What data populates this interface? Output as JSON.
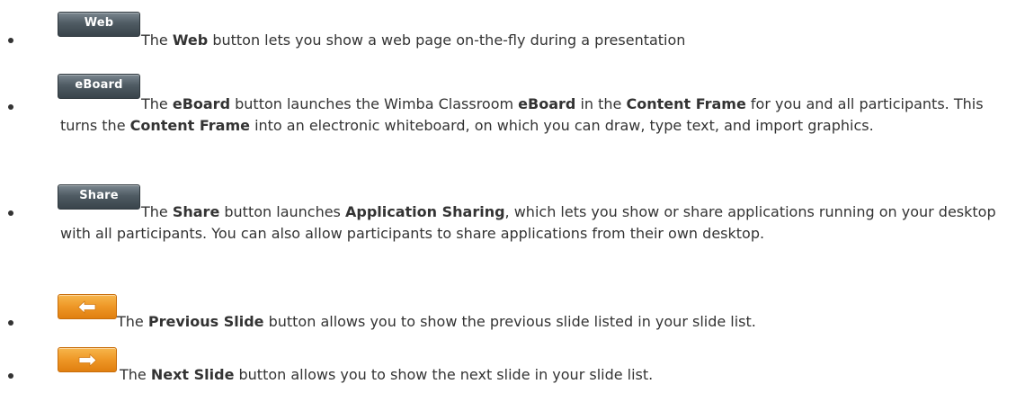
{
  "items": [
    {
      "button_label": "Web",
      "icon": "web-button-icon",
      "parts": [
        "The ",
        "Web",
        " button lets you show a web page on-the-fly during a presentation"
      ]
    },
    {
      "button_label": "eBoard",
      "icon": "eboard-button-icon",
      "parts": [
        "The ",
        "eBoard",
        " button launches the Wimba Classroom ",
        "eBoard",
        " in the ",
        "Content Frame",
        " for you and all participants. This turns the ",
        "Content Frame",
        " into an electronic whiteboard, on which you can draw, type text, and import graphics."
      ]
    },
    {
      "button_label": "Share",
      "icon": "share-button-icon",
      "parts": [
        "The ",
        "Share",
        " button launches ",
        "Application Sharing",
        ", which lets you show or share applications running on your desktop with all participants. You can also allow participants to share applications from their own desktop."
      ]
    },
    {
      "icon": "previous-slide-arrow-icon",
      "parts": [
        "The ",
        "Previous Slide",
        " button allows you to show the previous slide listed in your slide list."
      ]
    },
    {
      "icon": "next-slide-arrow-icon",
      "parts": [
        "The ",
        "Next Slide",
        " button allows you to show the next slide in your slide list."
      ]
    }
  ],
  "colors": {
    "text": "#333333",
    "dark_button": "#4f5b63",
    "orange_button": "#ee9726"
  }
}
